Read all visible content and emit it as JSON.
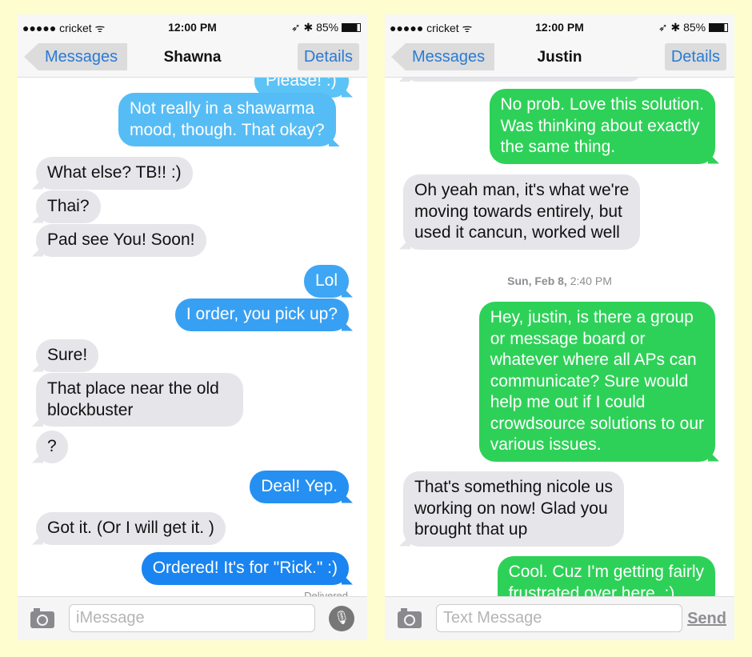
{
  "left": {
    "status": {
      "carrier": "●●●●● cricket ᯤ",
      "time": "12:00 PM",
      "right": "➶ ✱ 85%"
    },
    "nav": {
      "back": "Messages",
      "title": "Shawna",
      "details": "Details"
    },
    "messages": [
      {
        "from": "me",
        "text": "Please! :)"
      },
      {
        "from": "me",
        "text": "Not really in a shawarma\nmood, though. That okay?"
      },
      {
        "from": "them",
        "text": "What else? TB!! :)"
      },
      {
        "from": "them",
        "text": "Thai?"
      },
      {
        "from": "them",
        "text": "Pad see You! Soon!"
      },
      {
        "from": "me",
        "text": "Lol"
      },
      {
        "from": "me",
        "text": "I order, you pick up?"
      },
      {
        "from": "them",
        "text": "Sure!"
      },
      {
        "from": "them",
        "text": "That place near the old\nblockbuster"
      },
      {
        "from": "them",
        "text": "?"
      },
      {
        "from": "me",
        "text": "Deal! Yep."
      },
      {
        "from": "them",
        "text": "Got it. (Or I will get it. )"
      },
      {
        "from": "me",
        "text": "Ordered! It's for \"Rick.\" :)"
      }
    ],
    "delivered": "Delivered",
    "input_placeholder": "iMessage",
    "icons": [
      "camera-icon",
      "microphone-icon"
    ],
    "bubble_color": "#1a84f0"
  },
  "right": {
    "status": {
      "carrier": "●●●●● cricket ᯤ",
      "time": "12:00 PM",
      "right": "➶ ✱ 85%"
    },
    "nav": {
      "back": "Messages",
      "title": "Justin",
      "details": "Details"
    },
    "messages": [
      {
        "from": "me",
        "text": "No prob. Love this solution.\nWas thinking about exactly\nthe same thing."
      },
      {
        "from": "them",
        "text": "Oh yeah man, it's what we're\nmoving towards entirely, but\nused it cancun, worked well"
      },
      {
        "from": "me",
        "text": "Hey, justin, is there a group\nor message board or\nwhatever where all APs can\ncommunicate? Sure would\nhelp me out if I could\ncrowdsource solutions to our\nvarious issues."
      },
      {
        "from": "them",
        "text": "That's something nicole us\nworking on now! Glad you\nbrought that up"
      },
      {
        "from": "me",
        "text": "Cool. Cuz I'm getting fairly\nfrustrated over here. :)"
      }
    ],
    "timestamp": {
      "day": "Sun, Feb 8,",
      "time": "2:40 PM"
    },
    "input_placeholder": "Text Message",
    "send": "Send",
    "icons": [
      "camera-icon"
    ],
    "bubble_color": "#2ed158"
  }
}
